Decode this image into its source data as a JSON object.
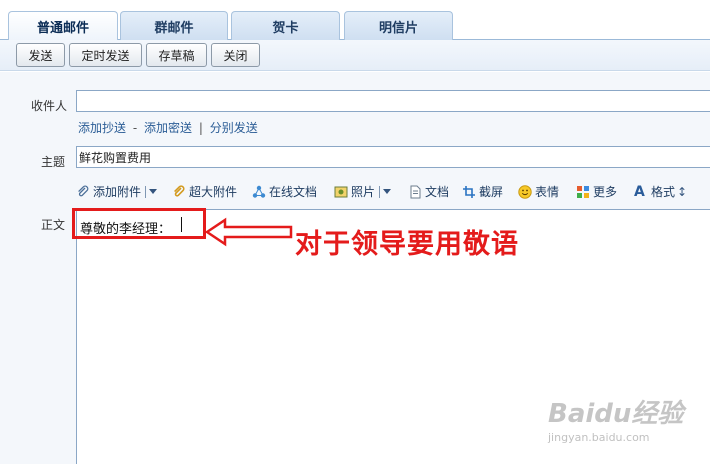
{
  "tabs": [
    {
      "label": "普通邮件",
      "active": true
    },
    {
      "label": "群邮件",
      "active": false
    },
    {
      "label": "贺卡",
      "active": false
    },
    {
      "label": "明信片",
      "active": false
    }
  ],
  "toolbar": {
    "send": "发送",
    "schedule": "定时发送",
    "save_draft": "存草稿",
    "close": "关闭"
  },
  "compose": {
    "to_label": "收件人",
    "to_value": "",
    "links": {
      "cc": "添加抄送",
      "dash": "-",
      "bcc": "添加密送",
      "bar": "|",
      "separate": "分别发送"
    },
    "subject_label": "主题",
    "subject_value": "鲜花购置费用",
    "body_label": "正文",
    "body_text": "尊敬的李经理："
  },
  "format_toolbar": [
    {
      "label": "添加附件",
      "icon": "paperclip-icon",
      "dropdown": true
    },
    {
      "label": "超大附件",
      "icon": "large-attachment-icon",
      "dropdown": false
    },
    {
      "label": "在线文档",
      "icon": "online-doc-icon",
      "dropdown": false
    },
    {
      "label": "照片",
      "icon": "photo-icon",
      "dropdown": true
    },
    {
      "label": "文档",
      "icon": "document-icon",
      "dropdown": false
    },
    {
      "label": "截屏",
      "icon": "screenshot-icon",
      "dropdown": false
    },
    {
      "label": "表情",
      "icon": "emoji-icon",
      "dropdown": false
    },
    {
      "label": "更多",
      "icon": "more-icon",
      "dropdown": false
    },
    {
      "label": "格式",
      "icon": "format-icon",
      "dropdown": false
    }
  ],
  "annotation": {
    "text": "对于领导要用敬语",
    "color": "#e41b1b"
  },
  "watermark": {
    "logo": "Baidu经验",
    "url": "jingyan.baidu.com"
  },
  "colors": {
    "tab_border": "#a9c3de",
    "field_border": "#8ba7c6",
    "link": "#2b5d96",
    "annotation_red": "#e41b1b"
  }
}
